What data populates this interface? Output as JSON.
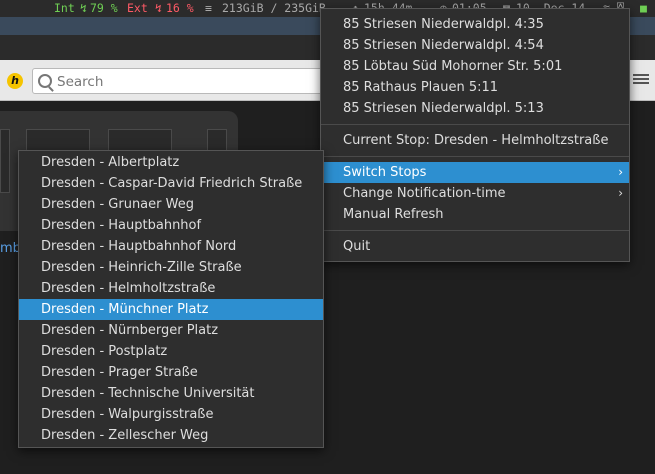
{
  "statusbar": {
    "int_label": "Int",
    "int_value": "79 %",
    "ext_label": "Ext",
    "ext_value": "16 %",
    "disk": "213GiB / 235GiB",
    "uptime": "15h 44m",
    "time": "01:05",
    "date": "10. Dec 14"
  },
  "browser": {
    "search_placeholder": "Search",
    "logo_letter": "h"
  },
  "page": {
    "partial_link": "mb"
  },
  "main_menu": {
    "departures": [
      "85 Striesen Niederwaldpl. 4:35",
      "85 Striesen Niederwaldpl. 4:54",
      "85 Löbtau Süd Mohorner Str. 5:01",
      "85 Rathaus Plauen 5:11",
      "85 Striesen Niederwaldpl. 5:13"
    ],
    "current_stop": "Current Stop: Dresden - Helmholtzstraße",
    "switch_stops": "Switch Stops",
    "change_notification": "Change Notification-time",
    "manual_refresh": "Manual Refresh",
    "quit": "Quit"
  },
  "stops": [
    "Dresden - Albertplatz",
    "Dresden - Caspar-David Friedrich Straße",
    "Dresden - Grunaer Weg",
    "Dresden - Hauptbahnhof",
    "Dresden - Hauptbahnhof Nord",
    "Dresden - Heinrich-Zille Straße",
    "Dresden - Helmholtzstraße",
    "Dresden - Münchner Platz",
    "Dresden - Nürnberger Platz",
    "Dresden - Postplatz",
    "Dresden - Prager Straße",
    "Dresden - Technische Universität",
    "Dresden - Walpurgisstraße",
    "Dresden - Zellescher Weg"
  ],
  "highlight_color": "#2d8fd0"
}
